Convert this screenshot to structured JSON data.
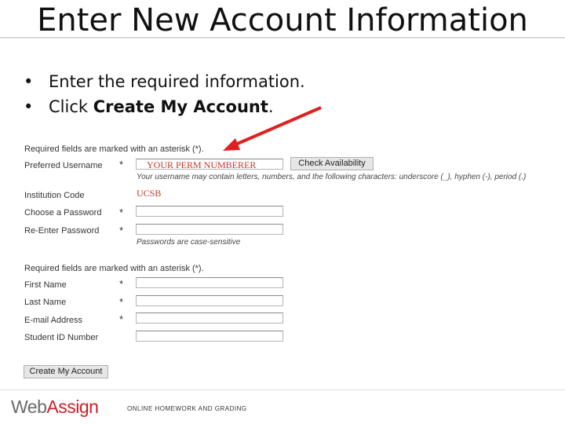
{
  "slide": {
    "title": "Enter New Account Information",
    "bullets": [
      {
        "text": "Enter the required information."
      },
      {
        "pre": "Click ",
        "bold": "Create My Account",
        "post": "."
      }
    ],
    "bullet_glyph": "•"
  },
  "form": {
    "required_note": "Required fields are marked with an asterisk (*).",
    "asterisk": "*",
    "preferred_username": {
      "label": "Preferred Username",
      "value": "YOUR PERM NUMBERER"
    },
    "check_availability_label": "Check Availability",
    "username_hint": "Your username may contain letters, numbers, and the following characters: underscore (_), hyphen (-), period (.)",
    "institution_code": {
      "label": "Institution Code",
      "value": "UCSB"
    },
    "choose_password": {
      "label": "Choose a Password"
    },
    "reenter_password": {
      "label": "Re-Enter Password"
    },
    "password_hint": "Passwords are case-sensitive",
    "required_note_2": "Required fields are marked with an asterisk (*).",
    "first_name": {
      "label": "First Name"
    },
    "last_name": {
      "label": "Last Name"
    },
    "email": {
      "label": "E-mail Address"
    },
    "student_id": {
      "label": "Student ID Number"
    },
    "create_button_label": "Create My Account"
  },
  "footer": {
    "logo_web": "Web",
    "logo_assign": "Assign",
    "tagline": "ONLINE HOMEWORK AND GRADING"
  },
  "colors": {
    "arrow": "#e02020",
    "logo_red": "#cc2027"
  }
}
